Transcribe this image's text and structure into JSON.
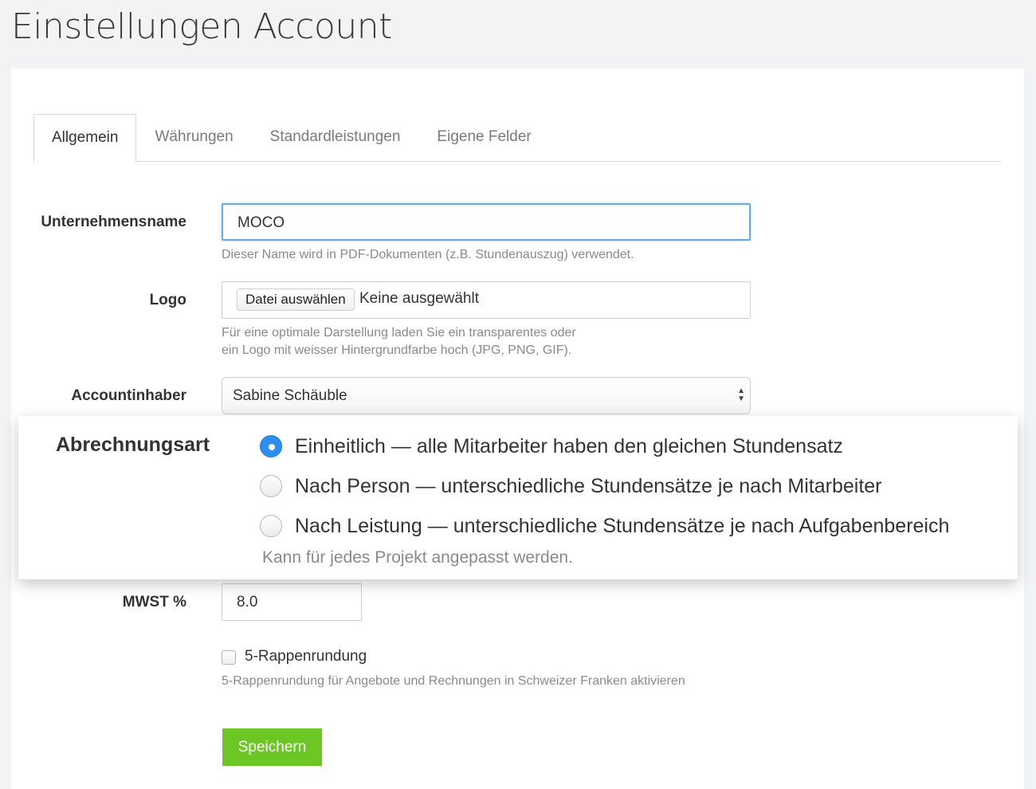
{
  "page": {
    "title": "Einstellungen Account"
  },
  "tabs": [
    {
      "label": "Allgemein",
      "active": true
    },
    {
      "label": "Währungen",
      "active": false
    },
    {
      "label": "Standardleistungen",
      "active": false
    },
    {
      "label": "Eigene Felder",
      "active": false
    }
  ],
  "form": {
    "company": {
      "label": "Unternehmensname",
      "value": "MOCO",
      "help": "Dieser Name wird in PDF-Dokumenten (z.B. Stundenauszug) verwendet."
    },
    "logo": {
      "label": "Logo",
      "button": "Datei auswählen",
      "status": "Keine ausgewählt",
      "help_line1": "Für eine optimale Darstellung laden Sie ein transparentes oder",
      "help_line2": "ein Logo mit weisser Hintergrundfarbe hoch (JPG, PNG, GIF)."
    },
    "owner": {
      "label": "Accountinhaber",
      "value": "Sabine Schäuble"
    },
    "billing": {
      "label": "Abrechnungsart",
      "options": [
        {
          "label": "Einheitlich — alle Mitarbeiter haben den gleichen Stundensatz",
          "checked": true
        },
        {
          "label": "Nach Person — unterschiedliche Stundensätze je nach Mitarbeiter",
          "checked": false
        },
        {
          "label": "Nach Leistung — unterschiedliche Stundensätze je nach Aufgabenbereich",
          "checked": false
        }
      ],
      "help": "Kann für jedes Projekt angepasst werden."
    },
    "vat": {
      "label": "MWST %",
      "value": "8.0"
    },
    "rounding": {
      "label": "5-Rappenrundung",
      "checked": false,
      "help": "5-Rappenrundung für Angebote und Rechnungen in Schweizer Franken aktivieren"
    },
    "save_label": "Speichern"
  },
  "colors": {
    "accent_green": "#6cc725",
    "focus_blue": "#6aa9e9",
    "radio_blue": "#2b8ef0"
  }
}
